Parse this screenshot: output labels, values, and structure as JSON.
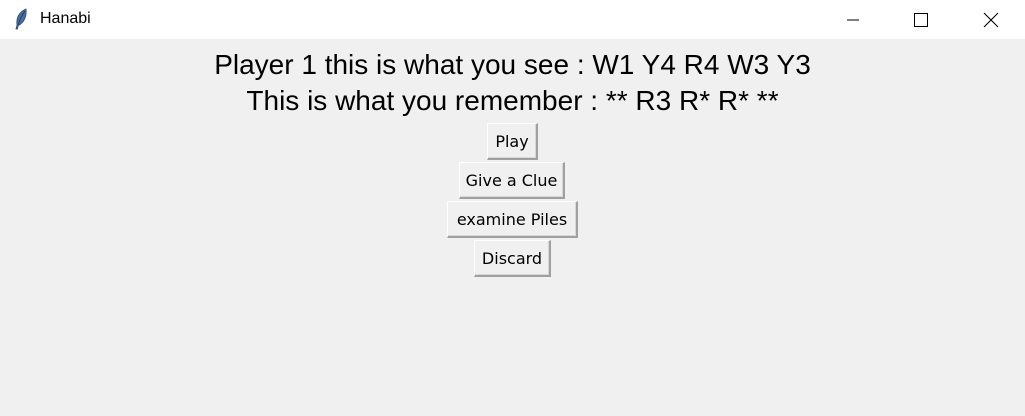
{
  "window": {
    "title": "Hanabi",
    "icon": "feather-icon",
    "controls": [
      "minimize-icon",
      "maximize-icon",
      "close-icon"
    ]
  },
  "main": {
    "see_text": "Player 1 this is what you see : W1 Y4 R4 W3 Y3",
    "remember_text": "This is what you remember : ** R3 R* R* **"
  },
  "buttons": {
    "play": "Play",
    "clue": "Give a Clue",
    "piles": "examine Piles",
    "discard": "Discard"
  }
}
